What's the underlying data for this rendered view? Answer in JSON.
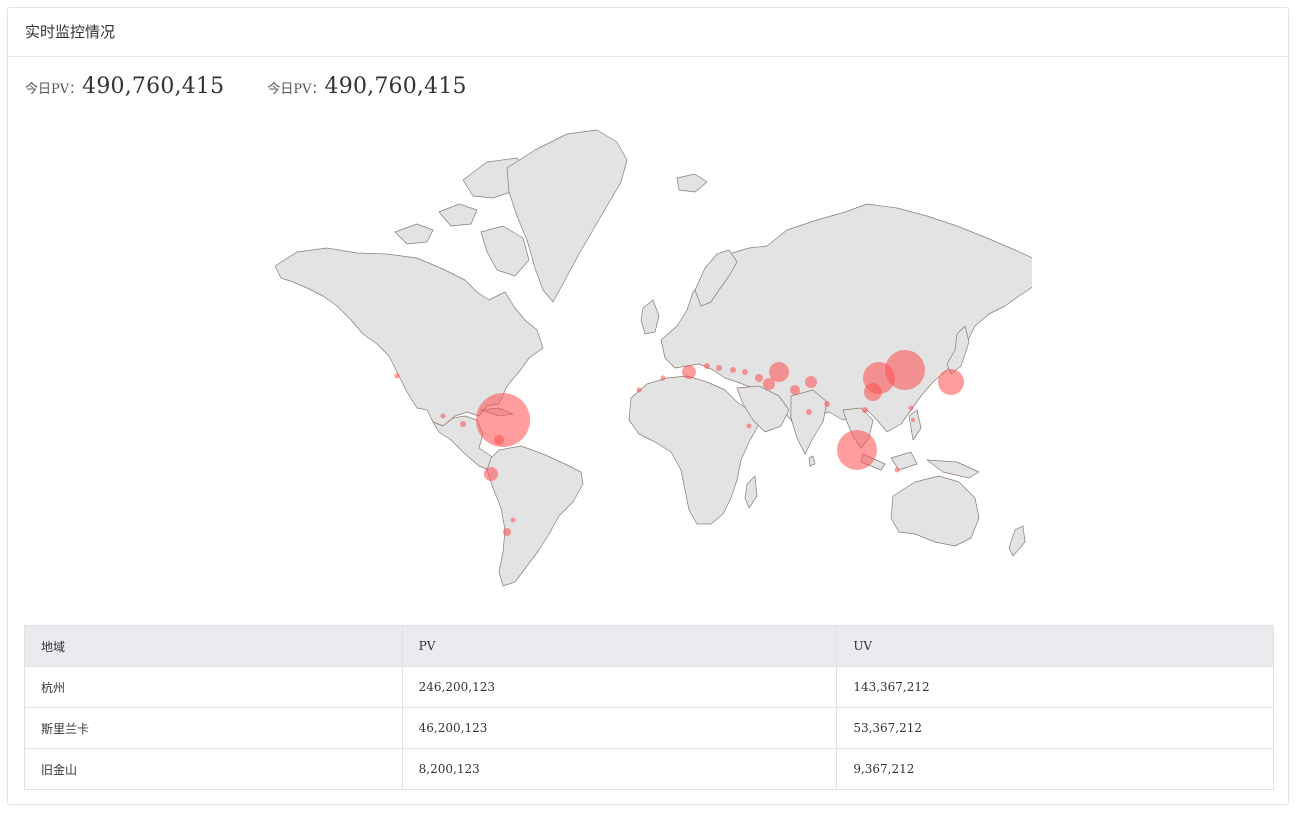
{
  "panel": {
    "title": "实时监控情况"
  },
  "stats": [
    {
      "label": "今日PV：",
      "value": "490,760,415"
    },
    {
      "label": "今日PV：",
      "value": "490,760,415"
    }
  ],
  "map": {
    "land_color": "#e3e3e3",
    "border_color": "#8c7a72",
    "bubble_color": "#ff4d4f"
  },
  "table": {
    "headers": [
      "地域",
      "PV",
      "UV"
    ],
    "rows": [
      [
        "杭州",
        "246,200,123",
        "143,367,212"
      ],
      [
        "斯里兰卡",
        "46,200,123",
        "53,367,212"
      ],
      [
        "旧金山",
        "8,200,123",
        "9,367,212"
      ]
    ]
  }
}
